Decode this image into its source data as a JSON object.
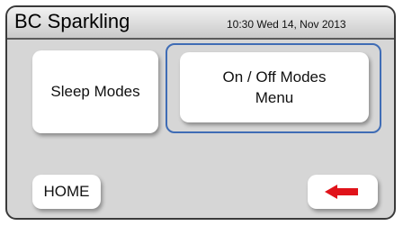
{
  "header": {
    "title": "BC Sparkling",
    "datetime": "10:30 Wed 14, Nov 2013"
  },
  "buttons": {
    "sleep_modes": "Sleep Modes",
    "on_off_line1": "On / Off Modes",
    "on_off_line2": "Menu",
    "home": "HOME"
  },
  "icons": {
    "back": "left-arrow-icon"
  },
  "colors": {
    "selection_outline": "#3f6cb5",
    "back_arrow": "#e0131a",
    "background": "#d6d6d6"
  }
}
